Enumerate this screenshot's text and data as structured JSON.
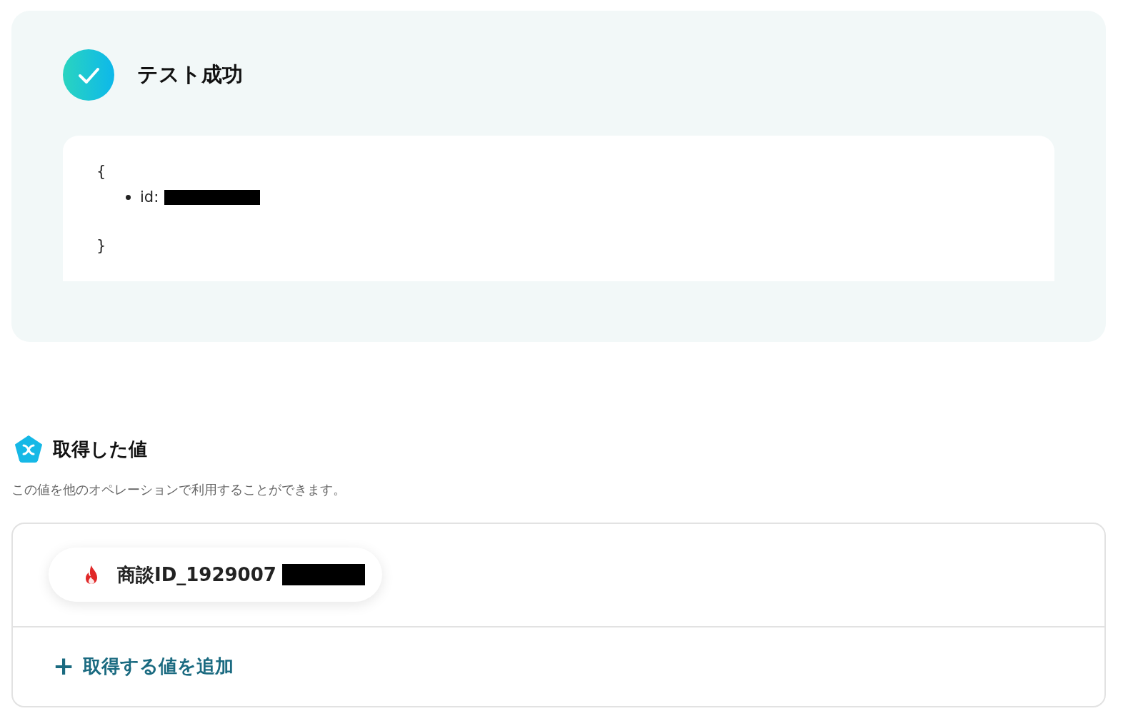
{
  "test_result": {
    "success": true,
    "title": "テスト成功",
    "output": {
      "open_brace": "{",
      "fields": [
        {
          "key": "id:",
          "redacted": true
        }
      ],
      "close_brace": "}"
    }
  },
  "retrieved_values": {
    "title": "取得した値",
    "description": "この値を他のオペレーションで利用することができます。",
    "items": [
      {
        "label": "商談ID_1929007",
        "redacted": true
      }
    ],
    "add_link": {
      "icon": "+",
      "label": "取得する値を追加"
    }
  }
}
